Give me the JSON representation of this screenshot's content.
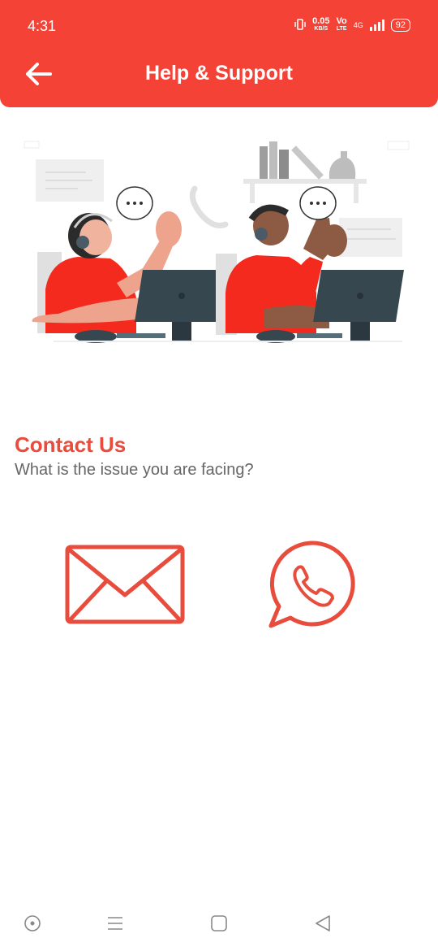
{
  "status_bar": {
    "time": "4:31",
    "speed_value": "0.05",
    "speed_unit": "KB/S",
    "network_top": "Vo",
    "network_bottom": "LTE",
    "network_type": "4G",
    "battery": "92"
  },
  "header": {
    "title": "Help & Support",
    "back_icon": "arrow-left-icon"
  },
  "contact": {
    "title": "Contact Us",
    "subtitle": "What is the issue you are facing?",
    "options": [
      {
        "icon": "mail-icon"
      },
      {
        "icon": "whatsapp-icon"
      }
    ]
  },
  "colors": {
    "primary": "#f44336",
    "accent_text": "#e74c3c",
    "subtitle_text": "#666666",
    "nav_icons": "#888888"
  },
  "navbar": {
    "items": [
      {
        "icon": "record-icon"
      },
      {
        "icon": "menu-icon"
      },
      {
        "icon": "home-square-icon"
      },
      {
        "icon": "back-triangle-icon"
      }
    ]
  }
}
